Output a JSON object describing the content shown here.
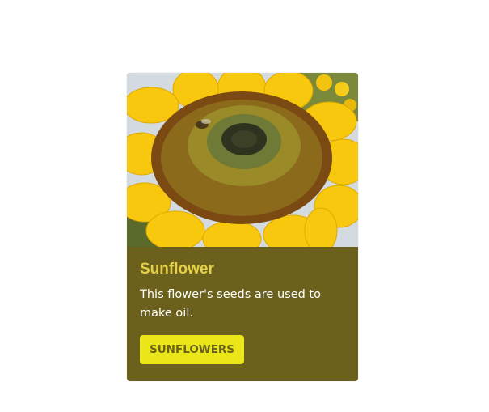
{
  "card": {
    "image_name": "sunflower-photo",
    "title": "Sunflower",
    "text": "This flower's seeds are used to make oil.",
    "button_label": "SUNFLOWERS"
  },
  "colors": {
    "card_background": "#6b611d",
    "title": "#e6d04a",
    "button_background": "#ebe61a",
    "button_text": "#6b611d"
  }
}
